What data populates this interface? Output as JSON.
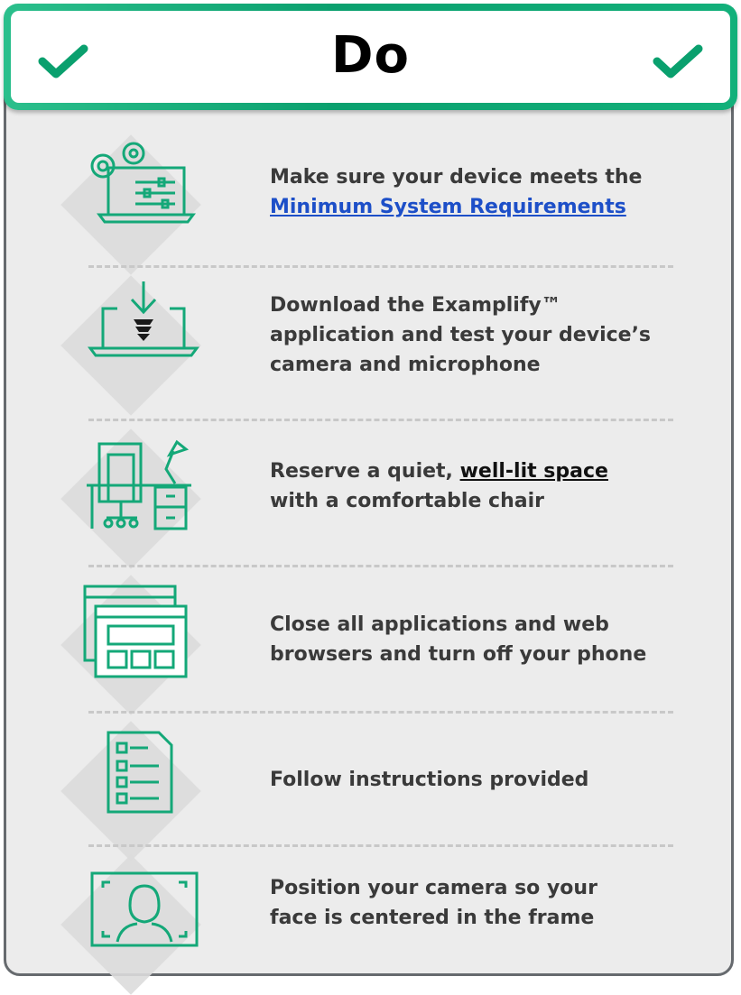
{
  "header": {
    "title": "Do",
    "accent_color": "#0aa06e",
    "left_icon": "checkmark-icon",
    "right_icon": "checkmark-icon"
  },
  "items": [
    {
      "icon": "laptop-settings-icon",
      "text_before": "Make sure your device meets the",
      "link_text": "Minimum System Requirements",
      "text_after": ""
    },
    {
      "icon": "laptop-download-icon",
      "text_line1": "Download the Examplify™",
      "text_line2": "application and test your device’s",
      "text_line3": "camera and microphone"
    },
    {
      "icon": "desk-workspace-icon",
      "text_before": "Reserve a quiet,",
      "emph_text": "well-lit space",
      "text_line2": "with a comfortable chair"
    },
    {
      "icon": "browser-windows-icon",
      "text_line1": "Close all applications and web",
      "text_line2": "browsers and turn off your phone"
    },
    {
      "icon": "checklist-document-icon",
      "text_line1": "Follow instructions provided"
    },
    {
      "icon": "camera-frame-face-icon",
      "text_line1": "Position your camera so your",
      "text_line2": "face is centered in the frame"
    }
  ]
}
